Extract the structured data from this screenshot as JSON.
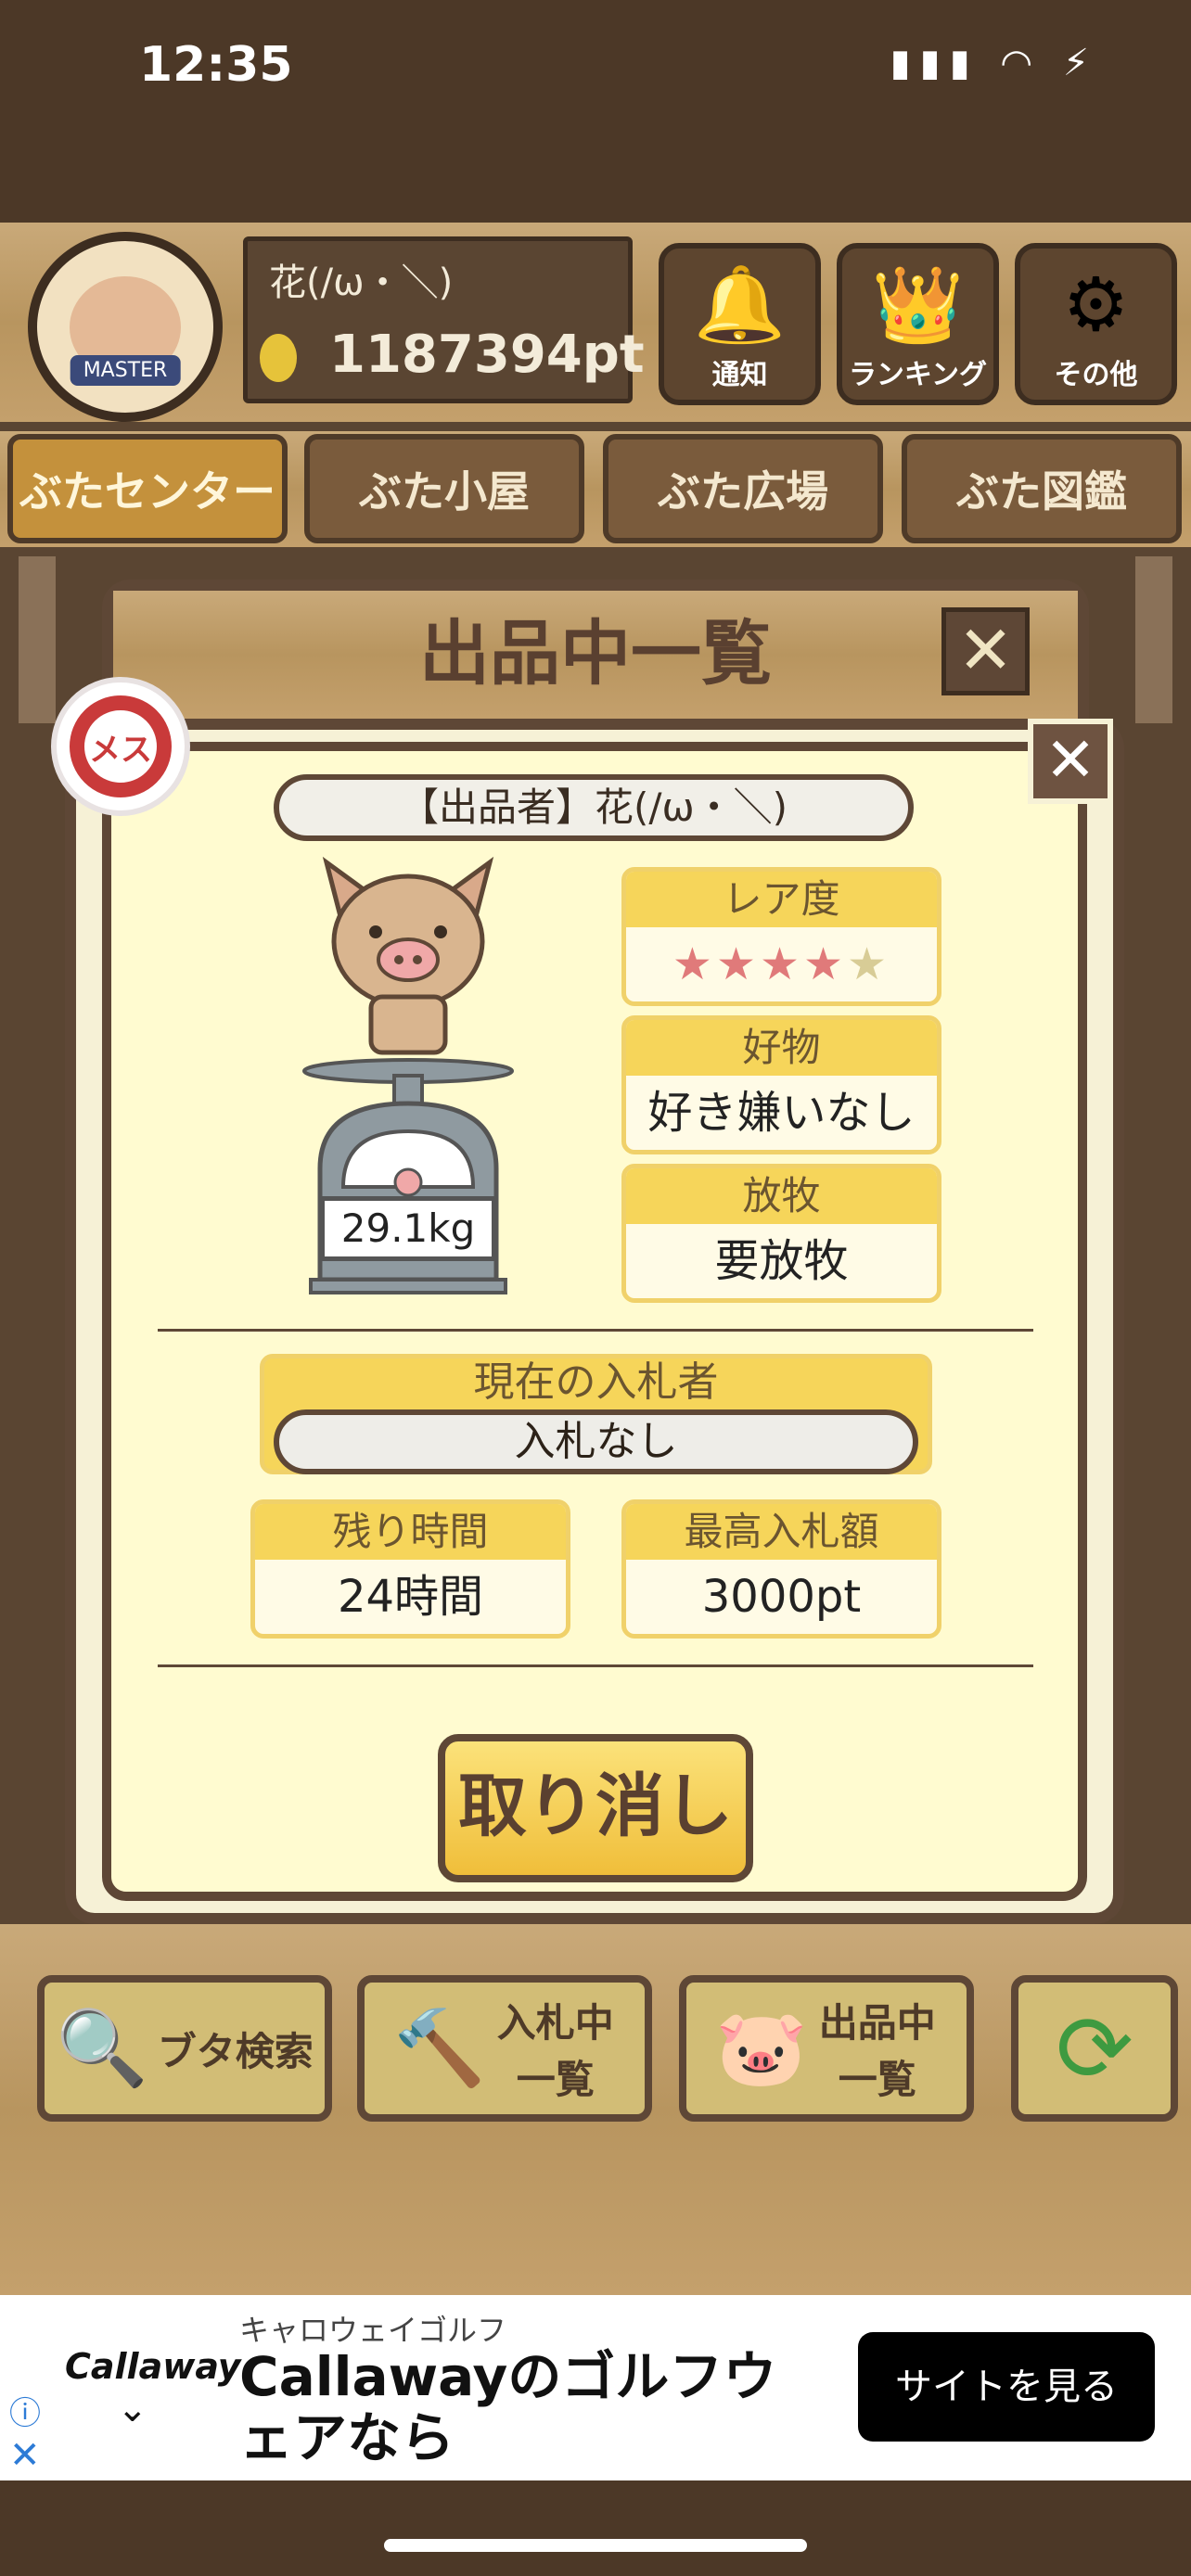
{
  "status_bar": {
    "time": "12:35",
    "icons": "▮▮▮ ◠ ⚡"
  },
  "header": {
    "avatar_label": "MASTER",
    "user_name": "花(/ω・＼)",
    "points": "1187394pt",
    "buttons": [
      {
        "label": "通知",
        "icon": "bell-icon",
        "glyph": "🔔"
      },
      {
        "label": "ランキング",
        "icon": "crown-icon",
        "glyph": "👑"
      },
      {
        "label": "その他",
        "icon": "gear-icon",
        "glyph": "⚙"
      }
    ]
  },
  "tabs": [
    {
      "label": "ぶたセンター",
      "active": true
    },
    {
      "label": "ぶた小屋",
      "active": false
    },
    {
      "label": "ぶた広場",
      "active": false
    },
    {
      "label": "ぶた図鑑",
      "active": false
    }
  ],
  "panel": {
    "title": "出品中一覧",
    "close": "✕"
  },
  "card": {
    "close": "✕",
    "gender_label": "メス",
    "seller": "【出品者】花(/ω・＼)",
    "weight": "29.1kg",
    "rarity": {
      "label": "レア度",
      "stars_filled": 4,
      "stars_total": 5
    },
    "favorite": {
      "label": "好物",
      "value": "好き嫌いなし"
    },
    "grazing": {
      "label": "放牧",
      "value": "要放牧"
    },
    "bidder": {
      "label": "現在の入札者",
      "value": "入札なし"
    },
    "remaining": {
      "label": "残り時間",
      "value": "24時間"
    },
    "highest_bid": {
      "label": "最高入札額",
      "value": "3000pt"
    },
    "cancel_label": "取り消し"
  },
  "bottom_nav": [
    {
      "label": "ブタ検索",
      "icon": "magnifier-icon",
      "glyph": "🔍"
    },
    {
      "label": "入札中一覧",
      "icon": "gavel-icon",
      "glyph": "🔨"
    },
    {
      "label": "出品中一覧",
      "icon": "pig-icon",
      "glyph": "🐷"
    }
  ],
  "refresh_glyph": "⟳",
  "ad": {
    "brand": "Callaway",
    "sponsor": "キャロウェイゴルフ",
    "title": "Callawayのゴルフウェアなら",
    "cta": "サイトを見る",
    "info": "ⓘ",
    "close": "✕"
  },
  "colors": {
    "accent": "#f6d55a",
    "frame": "#5e4736",
    "star_on": "#e07a7a"
  }
}
